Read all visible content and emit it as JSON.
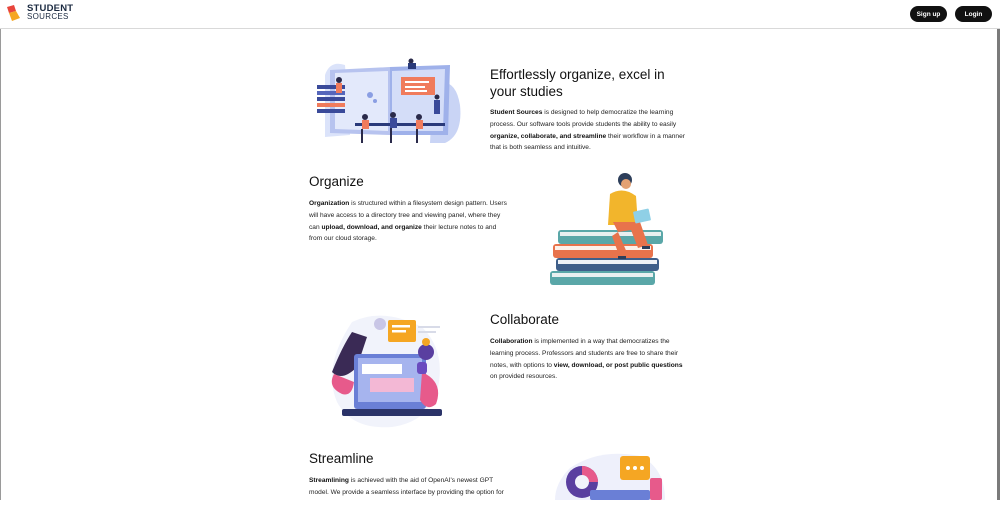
{
  "brand": {
    "line1": "STUDENT",
    "line2": "SOURCES",
    "colors": {
      "red": "#e8453c",
      "orange": "#f5a623",
      "navy": "#1b2a41"
    }
  },
  "nav": {
    "signup_label": "Sign up",
    "login_label": "Login"
  },
  "intro": {
    "title": "Effortlessly organize, excel in your studies",
    "p1": "Student Sources",
    "p2": " is designed to help democratize the learning process. Our software tools provide students the ability to easily ",
    "p3": "organize, collaborate, and streamline",
    "p4": " their workflow in a manner that is both seamless and intuitive."
  },
  "organize": {
    "title": "Organize",
    "p1": "Organization",
    "p2": " is structured within a filesystem design pattern. Users will have access to a directory tree and viewing panel, where they can ",
    "p3": "upload, download, and organize",
    "p4": " their lecture notes to and from our cloud storage."
  },
  "collaborate": {
    "title": "Collaborate",
    "p1": "Collaboration",
    "p2": " is implemented in a way that democratizes the learning process. Professors and students are free to share their notes, with options to ",
    "p3": "view, download, or post public questions",
    "p4": " on provided resources."
  },
  "streamline": {
    "title": "Streamline",
    "p1": "Streamlining",
    "p2": " is achieved with the aid of OpenAI's newest GPT model. We provide a seamless interface by providing the option for"
  }
}
